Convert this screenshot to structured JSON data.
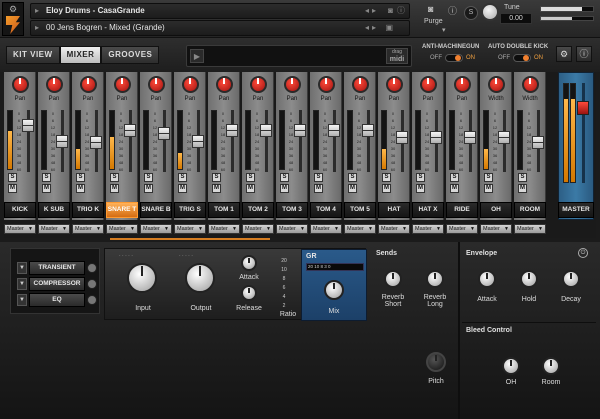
{
  "header": {
    "instrument": "Eloy Drums - CasaGrande",
    "preset": "00 Jens Bogren - Mixed (Grande)",
    "purge_label": "Purge",
    "tune_label": "Tune",
    "tune_value": "0.00"
  },
  "nav": {
    "tabs": [
      {
        "label": "KIT VIEW",
        "active": false
      },
      {
        "label": "MIXER",
        "active": true
      },
      {
        "label": "GROOVES",
        "active": false
      }
    ],
    "drag_midi_top": "drag",
    "drag_midi_bottom": "midi",
    "anti_machinegun": {
      "label": "ANTI-MACHINEGUN",
      "off": "OFF",
      "on": "ON"
    },
    "auto_double_kick": {
      "label": "AUTO DOUBLE KICK",
      "off": "OFF",
      "on": "ON"
    },
    "settings_icon": "gear-icon",
    "info_icon": "info-icon"
  },
  "mixer": {
    "scale": [
      "0",
      "6",
      "12",
      "18",
      "24",
      "30",
      "36",
      "48",
      "60"
    ],
    "solo_label": "S",
    "mute_label": "M",
    "channels": [
      {
        "name": "KICK",
        "knob_label": "Pan",
        "route": "Master",
        "meter": 0.65,
        "fader": 0.82
      },
      {
        "name": "K SUB",
        "knob_label": "Pan",
        "route": "Master",
        "meter": 0.0,
        "fader": 0.52
      },
      {
        "name": "TRIO K",
        "knob_label": "Pan",
        "route": "Master",
        "meter": 0.35,
        "fader": 0.5
      },
      {
        "name": "SNARE T",
        "knob_label": "Pan",
        "route": "Master",
        "meter": 0.55,
        "fader": 0.73,
        "selected": true
      },
      {
        "name": "SNARE B",
        "knob_label": "Pan",
        "route": "Master",
        "meter": 0.0,
        "fader": 0.68
      },
      {
        "name": "TRIG S",
        "knob_label": "Pan",
        "route": "Master",
        "meter": 0.28,
        "fader": 0.52
      },
      {
        "name": "TOM 1",
        "knob_label": "Pan",
        "route": "Master",
        "meter": 0.0,
        "fader": 0.73
      },
      {
        "name": "TOM 2",
        "knob_label": "Pan",
        "route": "Master",
        "meter": 0.0,
        "fader": 0.73
      },
      {
        "name": "TOM 3",
        "knob_label": "Pan",
        "route": "Master",
        "meter": 0.0,
        "fader": 0.73
      },
      {
        "name": "TOM 4",
        "knob_label": "Pan",
        "route": "Master",
        "meter": 0.0,
        "fader": 0.73
      },
      {
        "name": "TOM 5",
        "knob_label": "Pan",
        "route": "Master",
        "meter": 0.0,
        "fader": 0.73
      },
      {
        "name": "HAT",
        "knob_label": "Pan",
        "route": "Master",
        "meter": 0.35,
        "fader": 0.6
      },
      {
        "name": "HAT X",
        "knob_label": "Pan",
        "route": "Master",
        "meter": 0.0,
        "fader": 0.6
      },
      {
        "name": "RIDE",
        "knob_label": "Pan",
        "route": "Master",
        "meter": 0.0,
        "fader": 0.6
      },
      {
        "name": "OH",
        "knob_label": "Width",
        "route": "Master",
        "meter": 0.35,
        "fader": 0.6
      },
      {
        "name": "ROOM",
        "knob_label": "Width",
        "route": "Master",
        "meter": 0.0,
        "fader": 0.5
      }
    ],
    "master": {
      "name": "MASTER",
      "meter": 0.85
    }
  },
  "effects": {
    "items": [
      "TRANSIENT",
      "COMPRESSOR",
      "EQ"
    ]
  },
  "compressor": {
    "input_label": "Input",
    "output_label": "Output",
    "attack_label": "Attack",
    "release_label": "Release",
    "ratio_label": "Ratio",
    "ratio_ticks": [
      "20",
      "10",
      "8",
      "6",
      "4",
      "2"
    ],
    "gr_title": "GR",
    "gr_scale": "20  10 8 3 0",
    "mix_label": "Mix"
  },
  "sends": {
    "title": "Sends",
    "reverb_short": "Reverb Short",
    "reverb_long": "Reverb Long"
  },
  "envelope": {
    "title": "Envelope",
    "attack": "Attack",
    "hold": "Hold",
    "decay": "Decay"
  },
  "pitch_label": "Pitch",
  "bleed": {
    "title": "Bleed Control",
    "oh": "OH",
    "room": "Room"
  }
}
